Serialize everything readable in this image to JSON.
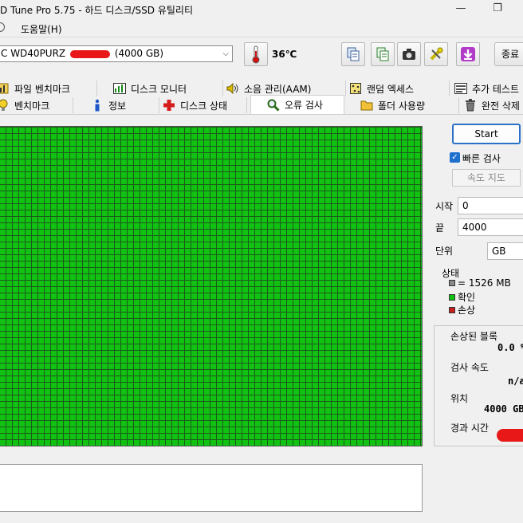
{
  "window": {
    "title": "D Tune Pro 5.75 - 하드 디스크/SSD 유틸리티",
    "minimize_glyph": "—",
    "restore_glyph": "❐"
  },
  "menu": {
    "help_label": "도움말(H)"
  },
  "toolbar": {
    "drive_prefix": "C WD40PURZ",
    "drive_capacity": "(4000 GB)",
    "temperature": "36℃",
    "exit_label": "종료"
  },
  "tabs_row1": [
    {
      "label": "파일 벤치마크",
      "icon": "file-benchmark-icon"
    },
    {
      "label": "디스크 모니터",
      "icon": "disk-monitor-icon"
    },
    {
      "label": "소음 관리(AAM)",
      "icon": "speaker-icon"
    },
    {
      "label": "랜덤 엑세스",
      "icon": "random-access-icon"
    },
    {
      "label": "추가 테스트",
      "icon": "extra-tests-icon"
    }
  ],
  "tabs_row2": [
    {
      "label": "벤치마크",
      "icon": "benchmark-icon"
    },
    {
      "label": "정보",
      "icon": "info-icon"
    },
    {
      "label": "디스크 상태",
      "icon": "health-cross-icon"
    },
    {
      "label": "오류 검사",
      "icon": "magnifier-icon"
    },
    {
      "label": "폴더 사용량",
      "icon": "folder-icon"
    },
    {
      "label": "완전 삭제",
      "icon": "trash-icon"
    }
  ],
  "errorscan": {
    "start_label": "Start",
    "quick_scan_label": "빠른 검사",
    "quick_scan_checked": true,
    "speed_map_label": "속도 지도",
    "start_field_label": "시작",
    "start_value": "0",
    "end_field_label": "끝",
    "end_value": "4000",
    "unit_label": "단위",
    "unit_value": "GB",
    "status_title": "상태",
    "legend": [
      {
        "label": "= 1526 MB",
        "color": "#8a8a8a"
      },
      {
        "label": "확인",
        "color": "#12c212"
      },
      {
        "label": "손상",
        "color": "#c81e1e"
      }
    ],
    "damaged_blocks_label": "손상된 블록",
    "damaged_blocks_value": "0.0 %",
    "scan_speed_label": "검사 속도",
    "scan_speed_value": "n/a",
    "position_label": "위치",
    "position_value": "4000 GB",
    "elapsed_label": "경과 시간"
  },
  "colors": {
    "ok_block": "#12c212",
    "grid_line": "#1b5a1b",
    "accent": "#2a71c7"
  }
}
